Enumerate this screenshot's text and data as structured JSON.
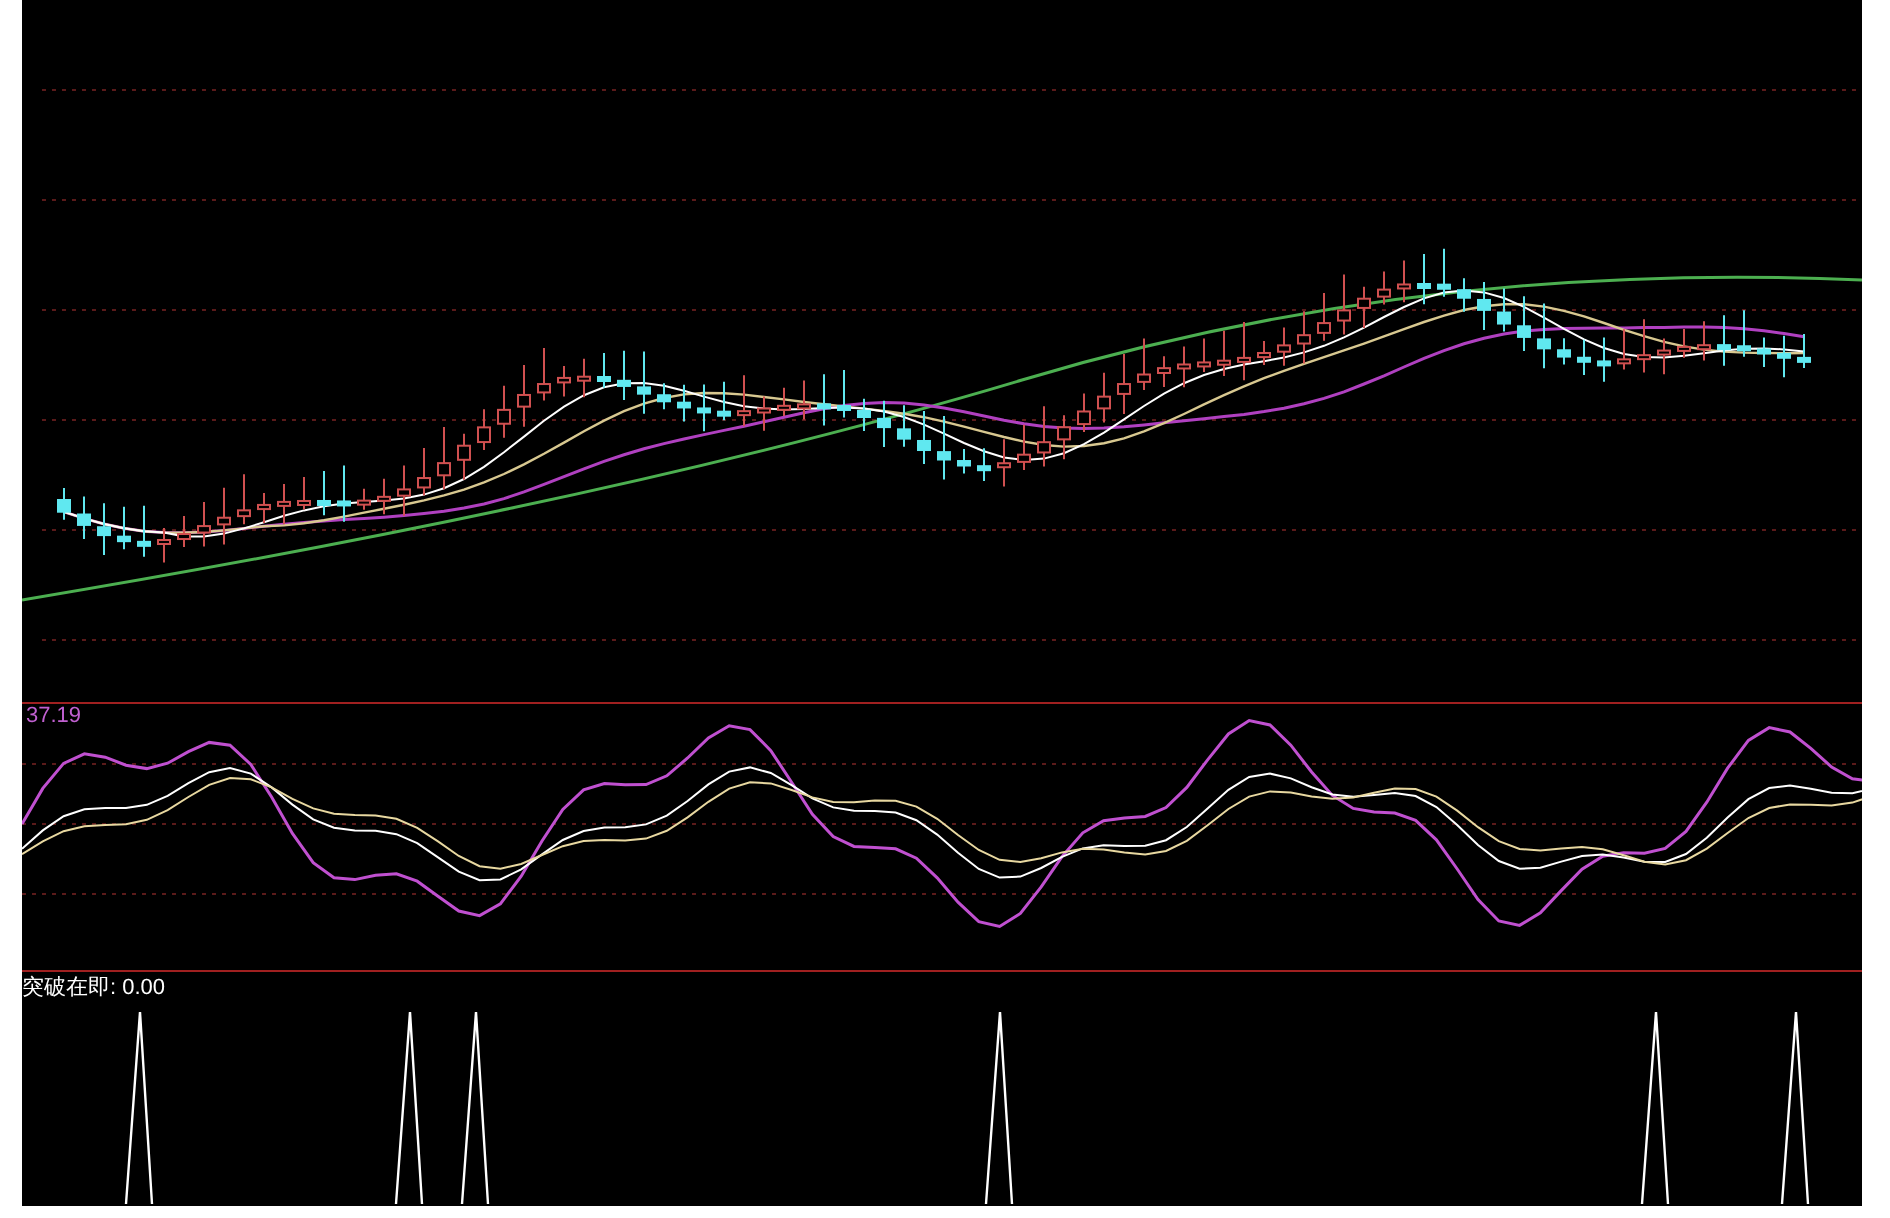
{
  "oscillator": {
    "value": "37.19"
  },
  "signal_panel": {
    "label": "突破在即: 0.00"
  }
}
